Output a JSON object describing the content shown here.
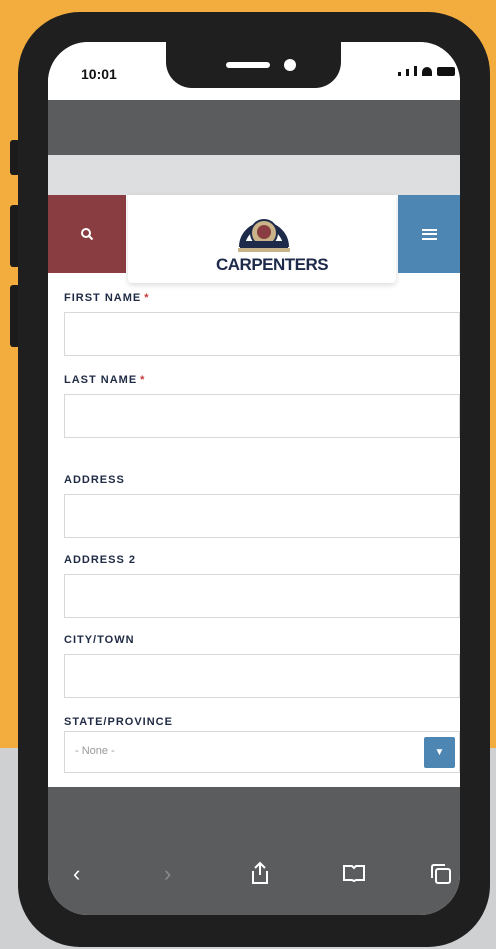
{
  "status_bar": {
    "time": "10:01"
  },
  "site": {
    "logo_text": "CARPENTERS",
    "search_icon": "search-icon",
    "menu_icon": "hamburger-menu-icon"
  },
  "form": {
    "fields": [
      {
        "label": "FIRST NAME",
        "required_mark": "*"
      },
      {
        "label": "LAST NAME",
        "required_mark": "*"
      },
      {
        "label": "ADDRESS"
      },
      {
        "label": "ADDRESS 2"
      },
      {
        "label": "CITY/TOWN"
      },
      {
        "label": "STATE/PROVINCE",
        "select_value": "- None -"
      }
    ]
  },
  "toolbar": {
    "back": "back-icon",
    "forward": "forward-icon",
    "share": "share-icon",
    "bookmarks": "bookmarks-icon",
    "tabs": "tabs-icon"
  },
  "colors": {
    "background": "#f3ad3e",
    "search_button": "#8a3d41",
    "menu_button": "#4d86b2",
    "label_text": "#1f2a44",
    "required": "#c83a3a"
  }
}
